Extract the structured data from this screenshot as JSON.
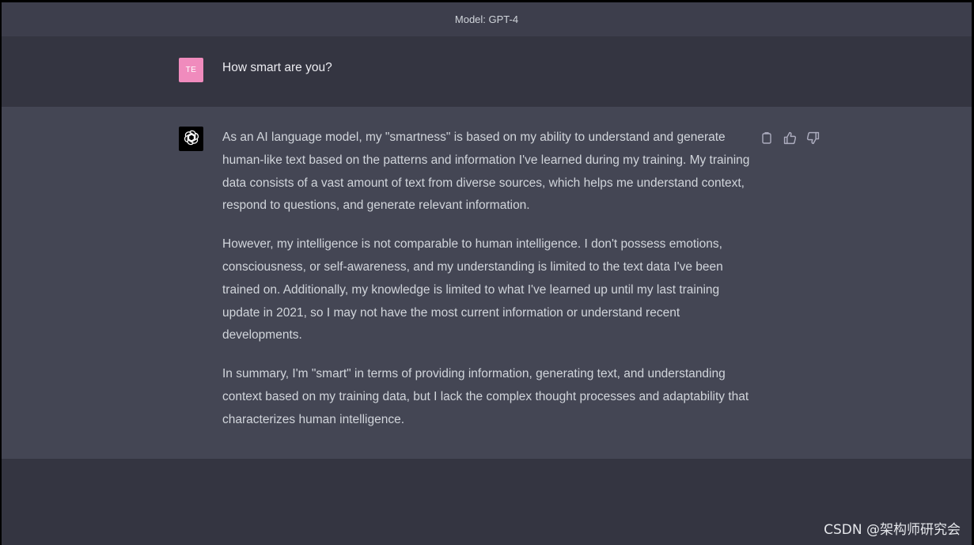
{
  "header": {
    "model_label": "Model: GPT-4"
  },
  "user": {
    "avatar_initials": "TE",
    "message": "How smart are you?"
  },
  "assistant": {
    "avatar_icon": "openai-logo-icon",
    "paragraphs": [
      "As an AI language model, my \"smartness\" is based on my ability to understand and generate human-like text based on the patterns and information I've learned during my training. My training data consists of a vast amount of text from diverse sources, which helps me understand context, respond to questions, and generate relevant information.",
      "However, my intelligence is not comparable to human intelligence. I don't possess emotions, consciousness, or self-awareness, and my understanding is limited to the text data I've been trained on. Additionally, my knowledge is limited to what I've learned up until my last training update in 2021, so I may not have the most current information or understand recent developments.",
      "In summary, I'm \"smart\" in terms of providing information, generating text, and understanding context based on my training data, but I lack the complex thought processes and adaptability that characterizes human intelligence."
    ],
    "actions": [
      "copy-icon",
      "thumbs-up-icon",
      "thumbs-down-icon"
    ]
  },
  "watermark": "CSDN @架构师研究会",
  "colors": {
    "header_bg": "#3d3e4c",
    "user_bg": "#343541",
    "assistant_bg": "#444654",
    "user_avatar": "#f08bbd",
    "text": "#d1d5db"
  }
}
